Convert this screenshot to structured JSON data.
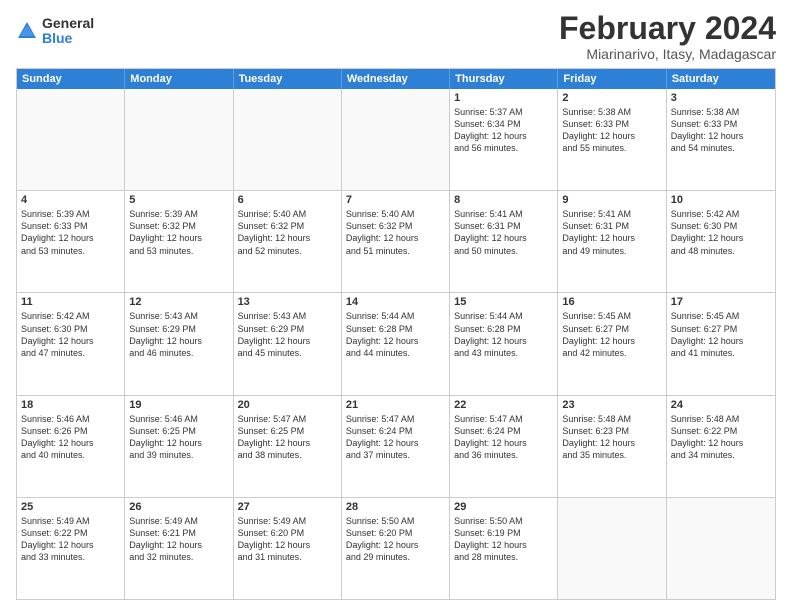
{
  "logo": {
    "general": "General",
    "blue": "Blue"
  },
  "title": "February 2024",
  "location": "Miarinarivo, Itasy, Madagascar",
  "headers": [
    "Sunday",
    "Monday",
    "Tuesday",
    "Wednesday",
    "Thursday",
    "Friday",
    "Saturday"
  ],
  "rows": [
    [
      {
        "day": "",
        "lines": []
      },
      {
        "day": "",
        "lines": []
      },
      {
        "day": "",
        "lines": []
      },
      {
        "day": "",
        "lines": []
      },
      {
        "day": "1",
        "lines": [
          "Sunrise: 5:37 AM",
          "Sunset: 6:34 PM",
          "Daylight: 12 hours",
          "and 56 minutes."
        ]
      },
      {
        "day": "2",
        "lines": [
          "Sunrise: 5:38 AM",
          "Sunset: 6:33 PM",
          "Daylight: 12 hours",
          "and 55 minutes."
        ]
      },
      {
        "day": "3",
        "lines": [
          "Sunrise: 5:38 AM",
          "Sunset: 6:33 PM",
          "Daylight: 12 hours",
          "and 54 minutes."
        ]
      }
    ],
    [
      {
        "day": "4",
        "lines": [
          "Sunrise: 5:39 AM",
          "Sunset: 6:33 PM",
          "Daylight: 12 hours",
          "and 53 minutes."
        ]
      },
      {
        "day": "5",
        "lines": [
          "Sunrise: 5:39 AM",
          "Sunset: 6:32 PM",
          "Daylight: 12 hours",
          "and 53 minutes."
        ]
      },
      {
        "day": "6",
        "lines": [
          "Sunrise: 5:40 AM",
          "Sunset: 6:32 PM",
          "Daylight: 12 hours",
          "and 52 minutes."
        ]
      },
      {
        "day": "7",
        "lines": [
          "Sunrise: 5:40 AM",
          "Sunset: 6:32 PM",
          "Daylight: 12 hours",
          "and 51 minutes."
        ]
      },
      {
        "day": "8",
        "lines": [
          "Sunrise: 5:41 AM",
          "Sunset: 6:31 PM",
          "Daylight: 12 hours",
          "and 50 minutes."
        ]
      },
      {
        "day": "9",
        "lines": [
          "Sunrise: 5:41 AM",
          "Sunset: 6:31 PM",
          "Daylight: 12 hours",
          "and 49 minutes."
        ]
      },
      {
        "day": "10",
        "lines": [
          "Sunrise: 5:42 AM",
          "Sunset: 6:30 PM",
          "Daylight: 12 hours",
          "and 48 minutes."
        ]
      }
    ],
    [
      {
        "day": "11",
        "lines": [
          "Sunrise: 5:42 AM",
          "Sunset: 6:30 PM",
          "Daylight: 12 hours",
          "and 47 minutes."
        ]
      },
      {
        "day": "12",
        "lines": [
          "Sunrise: 5:43 AM",
          "Sunset: 6:29 PM",
          "Daylight: 12 hours",
          "and 46 minutes."
        ]
      },
      {
        "day": "13",
        "lines": [
          "Sunrise: 5:43 AM",
          "Sunset: 6:29 PM",
          "Daylight: 12 hours",
          "and 45 minutes."
        ]
      },
      {
        "day": "14",
        "lines": [
          "Sunrise: 5:44 AM",
          "Sunset: 6:28 PM",
          "Daylight: 12 hours",
          "and 44 minutes."
        ]
      },
      {
        "day": "15",
        "lines": [
          "Sunrise: 5:44 AM",
          "Sunset: 6:28 PM",
          "Daylight: 12 hours",
          "and 43 minutes."
        ]
      },
      {
        "day": "16",
        "lines": [
          "Sunrise: 5:45 AM",
          "Sunset: 6:27 PM",
          "Daylight: 12 hours",
          "and 42 minutes."
        ]
      },
      {
        "day": "17",
        "lines": [
          "Sunrise: 5:45 AM",
          "Sunset: 6:27 PM",
          "Daylight: 12 hours",
          "and 41 minutes."
        ]
      }
    ],
    [
      {
        "day": "18",
        "lines": [
          "Sunrise: 5:46 AM",
          "Sunset: 6:26 PM",
          "Daylight: 12 hours",
          "and 40 minutes."
        ]
      },
      {
        "day": "19",
        "lines": [
          "Sunrise: 5:46 AM",
          "Sunset: 6:25 PM",
          "Daylight: 12 hours",
          "and 39 minutes."
        ]
      },
      {
        "day": "20",
        "lines": [
          "Sunrise: 5:47 AM",
          "Sunset: 6:25 PM",
          "Daylight: 12 hours",
          "and 38 minutes."
        ]
      },
      {
        "day": "21",
        "lines": [
          "Sunrise: 5:47 AM",
          "Sunset: 6:24 PM",
          "Daylight: 12 hours",
          "and 37 minutes."
        ]
      },
      {
        "day": "22",
        "lines": [
          "Sunrise: 5:47 AM",
          "Sunset: 6:24 PM",
          "Daylight: 12 hours",
          "and 36 minutes."
        ]
      },
      {
        "day": "23",
        "lines": [
          "Sunrise: 5:48 AM",
          "Sunset: 6:23 PM",
          "Daylight: 12 hours",
          "and 35 minutes."
        ]
      },
      {
        "day": "24",
        "lines": [
          "Sunrise: 5:48 AM",
          "Sunset: 6:22 PM",
          "Daylight: 12 hours",
          "and 34 minutes."
        ]
      }
    ],
    [
      {
        "day": "25",
        "lines": [
          "Sunrise: 5:49 AM",
          "Sunset: 6:22 PM",
          "Daylight: 12 hours",
          "and 33 minutes."
        ]
      },
      {
        "day": "26",
        "lines": [
          "Sunrise: 5:49 AM",
          "Sunset: 6:21 PM",
          "Daylight: 12 hours",
          "and 32 minutes."
        ]
      },
      {
        "day": "27",
        "lines": [
          "Sunrise: 5:49 AM",
          "Sunset: 6:20 PM",
          "Daylight: 12 hours",
          "and 31 minutes."
        ]
      },
      {
        "day": "28",
        "lines": [
          "Sunrise: 5:50 AM",
          "Sunset: 6:20 PM",
          "Daylight: 12 hours",
          "and 29 minutes."
        ]
      },
      {
        "day": "29",
        "lines": [
          "Sunrise: 5:50 AM",
          "Sunset: 6:19 PM",
          "Daylight: 12 hours",
          "and 28 minutes."
        ]
      },
      {
        "day": "",
        "lines": []
      },
      {
        "day": "",
        "lines": []
      }
    ]
  ]
}
